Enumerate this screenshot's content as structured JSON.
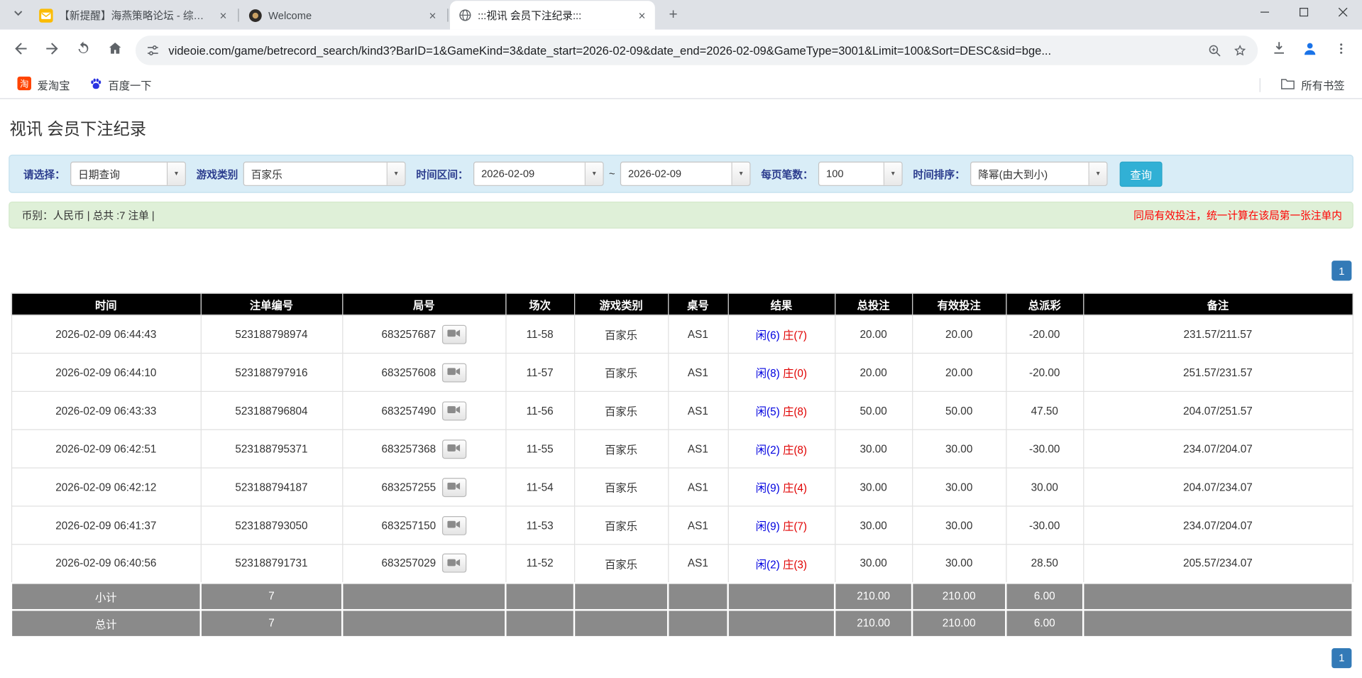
{
  "browser": {
    "tabs": [
      {
        "title": "【新提醒】海燕策略论坛 - 综合...",
        "active": false
      },
      {
        "title": "Welcome",
        "active": false
      },
      {
        "title": ":::视讯 会员下注纪录:::",
        "active": true
      }
    ],
    "new_tab": "+",
    "url": "videoie.com/game/betrecord_search/kind3?BarID=1&GameKind=3&date_start=2026-02-09&date_end=2026-02-09&GameType=3001&Limit=100&Sort=DESC&sid=bge...",
    "bookmarks": {
      "taobao": "爱淘宝",
      "baidu": "百度一下",
      "all_bookmarks": "所有书签"
    },
    "icons": [
      "tab-search-icon",
      "mail-favicon-icon",
      "game-logo-favicon-icon",
      "globe-favicon-icon",
      "close-icon",
      "back-icon",
      "forward-icon",
      "reload-icon",
      "home-icon",
      "tune-icon",
      "zoom-icon",
      "star-icon",
      "download-icon",
      "profile-icon",
      "kebab-menu-icon",
      "folder-icon",
      "taobao-icon",
      "baidu-paw-icon",
      "video-camera-icon",
      "minimize-icon",
      "maximize-icon"
    ]
  },
  "page": {
    "title": "视讯 会员下注纪录",
    "filters": {
      "mode_label": "请选择：",
      "mode_value": "日期查询",
      "game_label": "游戏类别",
      "game_value": "百家乐",
      "range_label": "时间区间：",
      "date_start": "2026-02-09",
      "tilde": "~",
      "date_end": "2026-02-09",
      "limit_label": "每页笔数：",
      "limit_value": "100",
      "sort_label": "时间排序：",
      "sort_value": "降幂(由大到小)",
      "search_button": "查询",
      "dropdown_arrow": "▼"
    },
    "summary": {
      "left": "币别：人民币 | 总共 :7 注单 |",
      "right": "同局有效投注，统一计算在该局第一张注单内"
    },
    "pagination": "1",
    "table": {
      "headers": [
        "时间",
        "注单编号",
        "局号",
        "场次",
        "游戏类别",
        "桌号",
        "结果",
        "总投注",
        "有效投注",
        "总派彩",
        "备注"
      ],
      "rows": [
        {
          "time": "2026-02-09 06:44:43",
          "bet_no": "523188798974",
          "round_no": "683257687",
          "session": "11-58",
          "game": "百家乐",
          "table_no": "AS1",
          "player": "闲(6)",
          "banker": "庄(7)",
          "total_bet": "20.00",
          "valid_bet": "20.00",
          "payout": "-20.00",
          "note": "231.57/211.57"
        },
        {
          "time": "2026-02-09 06:44:10",
          "bet_no": "523188797916",
          "round_no": "683257608",
          "session": "11-57",
          "game": "百家乐",
          "table_no": "AS1",
          "player": "闲(8)",
          "banker": "庄(0)",
          "total_bet": "20.00",
          "valid_bet": "20.00",
          "payout": "-20.00",
          "note": "251.57/231.57"
        },
        {
          "time": "2026-02-09 06:43:33",
          "bet_no": "523188796804",
          "round_no": "683257490",
          "session": "11-56",
          "game": "百家乐",
          "table_no": "AS1",
          "player": "闲(5)",
          "banker": "庄(8)",
          "total_bet": "50.00",
          "valid_bet": "50.00",
          "payout": "47.50",
          "note": "204.07/251.57"
        },
        {
          "time": "2026-02-09 06:42:51",
          "bet_no": "523188795371",
          "round_no": "683257368",
          "session": "11-55",
          "game": "百家乐",
          "table_no": "AS1",
          "player": "闲(2)",
          "banker": "庄(8)",
          "total_bet": "30.00",
          "valid_bet": "30.00",
          "payout": "-30.00",
          "note": "234.07/204.07"
        },
        {
          "time": "2026-02-09 06:42:12",
          "bet_no": "523188794187",
          "round_no": "683257255",
          "session": "11-54",
          "game": "百家乐",
          "table_no": "AS1",
          "player": "闲(9)",
          "banker": "庄(4)",
          "total_bet": "30.00",
          "valid_bet": "30.00",
          "payout": "30.00",
          "note": "204.07/234.07"
        },
        {
          "time": "2026-02-09 06:41:37",
          "bet_no": "523188793050",
          "round_no": "683257150",
          "session": "11-53",
          "game": "百家乐",
          "table_no": "AS1",
          "player": "闲(9)",
          "banker": "庄(7)",
          "total_bet": "30.00",
          "valid_bet": "30.00",
          "payout": "-30.00",
          "note": "234.07/204.07"
        },
        {
          "time": "2026-02-09 06:40:56",
          "bet_no": "523188791731",
          "round_no": "683257029",
          "session": "11-52",
          "game": "百家乐",
          "table_no": "AS1",
          "player": "闲(2)",
          "banker": "庄(3)",
          "total_bet": "30.00",
          "valid_bet": "30.00",
          "payout": "28.50",
          "note": "205.57/234.07"
        }
      ],
      "subtotal": {
        "label": "小计",
        "count": "7",
        "total_bet": "210.00",
        "valid_bet": "210.00",
        "payout": "6.00"
      },
      "grand_total": {
        "label": "总计",
        "count": "7",
        "total_bet": "210.00",
        "valid_bet": "210.00",
        "payout": "6.00"
      }
    },
    "colors": {
      "accent_blue": "#337ab7",
      "negative_red": "#e60000",
      "player_blue": "#0000e0",
      "banker_red": "#e00000",
      "search_button_teal": "#31b0d5",
      "filter_bar_bg": "#d9edf7",
      "summary_bar_bg": "#dff0d8",
      "table_header_bg": "#000000",
      "summary_row_bg": "#8a8a8a"
    }
  }
}
